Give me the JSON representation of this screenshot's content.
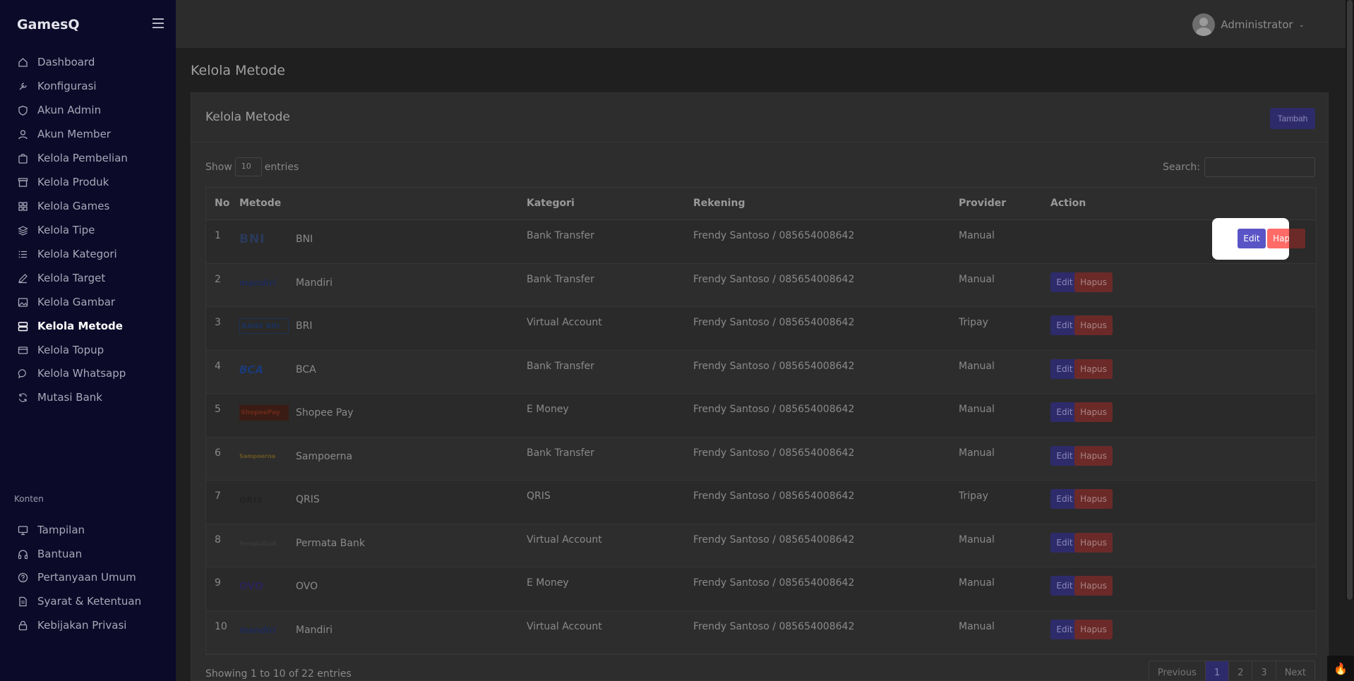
{
  "app": {
    "brand": "GamesQ"
  },
  "sidebar": {
    "items": [
      {
        "label": "Dashboard",
        "icon": "home-icon"
      },
      {
        "label": "Konfigurasi",
        "icon": "wrench-icon"
      },
      {
        "label": "Akun Admin",
        "icon": "shield-icon"
      },
      {
        "label": "Akun Member",
        "icon": "user-icon"
      },
      {
        "label": "Kelola Pembelian",
        "icon": "bag-icon"
      },
      {
        "label": "Kelola Produk",
        "icon": "archive-icon"
      },
      {
        "label": "Kelola Games",
        "icon": "grid-icon"
      },
      {
        "label": "Kelola Tipe",
        "icon": "layers-icon"
      },
      {
        "label": "Kelola Kategori",
        "icon": "list-icon"
      },
      {
        "label": "Kelola Target",
        "icon": "pencil-icon"
      },
      {
        "label": "Kelola Gambar",
        "icon": "image-icon"
      },
      {
        "label": "Kelola Metode",
        "icon": "server-icon",
        "active": true
      },
      {
        "label": "Kelola Topup",
        "icon": "credit-card-icon"
      },
      {
        "label": "Kelola Whatsapp",
        "icon": "chat-icon"
      },
      {
        "label": "Mutasi Bank",
        "icon": "refresh-icon"
      }
    ],
    "section_label": "Konten",
    "content_items": [
      {
        "label": "Tampilan",
        "icon": "monitor-icon"
      },
      {
        "label": "Bantuan",
        "icon": "headphones-icon"
      },
      {
        "label": "Pertanyaan Umum",
        "icon": "help-circle-icon"
      },
      {
        "label": "Syarat & Ketentuan",
        "icon": "file-icon"
      },
      {
        "label": "Kebijakan Privasi",
        "icon": "lock-icon"
      }
    ]
  },
  "header": {
    "user_name": "Administrator"
  },
  "page": {
    "title": "Kelola Metode"
  },
  "card": {
    "title": "Kelola Metode",
    "add_button": "Tambah",
    "show_label": "Show",
    "entries_value": "10",
    "entries_label": "entries",
    "search_label": "Search:"
  },
  "table": {
    "columns": [
      "No",
      "Metode",
      "Kategori",
      "Rekening",
      "Provider",
      "Action"
    ],
    "rows": [
      {
        "no": "1",
        "logo": "BNI",
        "metode": "BNI",
        "kategori": "Bank Transfer",
        "rekening": "Frendy Santoso / 085654008642",
        "provider": "Manual"
      },
      {
        "no": "2",
        "logo": "mandiri",
        "metode": "Mandiri",
        "kategori": "Bank Transfer",
        "rekening": "Frendy Santoso / 085654008642",
        "provider": "Manual"
      },
      {
        "no": "3",
        "logo": "BANK BRI",
        "metode": "BRI",
        "kategori": "Virtual Account",
        "rekening": "Frendy Santoso / 085654008642",
        "provider": "Tripay"
      },
      {
        "no": "4",
        "logo": "BCA",
        "metode": "BCA",
        "kategori": "Bank Transfer",
        "rekening": "Frendy Santoso / 085654008642",
        "provider": "Manual"
      },
      {
        "no": "5",
        "logo": "ShopeePay",
        "metode": "Shopee Pay",
        "kategori": "E Money",
        "rekening": "Frendy Santoso / 085654008642",
        "provider": "Manual"
      },
      {
        "no": "6",
        "logo": "Sampoerna",
        "metode": "Sampoerna",
        "kategori": "Bank Transfer",
        "rekening": "Frendy Santoso / 085654008642",
        "provider": "Manual"
      },
      {
        "no": "7",
        "logo": "QRIS",
        "metode": "QRIS",
        "kategori": "QRIS",
        "rekening": "Frendy Santoso / 085654008642",
        "provider": "Tripay"
      },
      {
        "no": "8",
        "logo": "PermataBank",
        "metode": "Permata Bank",
        "kategori": "Virtual Account",
        "rekening": "Frendy Santoso / 085654008642",
        "provider": "Manual"
      },
      {
        "no": "9",
        "logo": "OVO",
        "metode": "OVO",
        "kategori": "E Money",
        "rekening": "Frendy Santoso / 085654008642",
        "provider": "Manual"
      },
      {
        "no": "10",
        "logo": "mandiri",
        "metode": "Mandiri",
        "kategori": "Virtual Account",
        "rekening": "Frendy Santoso / 085654008642",
        "provider": "Manual"
      }
    ],
    "edit_label": "Edit",
    "delete_label": "Hapus"
  },
  "footer": {
    "info": "Showing 1 to 10 of 22 entries",
    "pagination": [
      "Previous",
      "1",
      "2",
      "3",
      "Next"
    ]
  }
}
